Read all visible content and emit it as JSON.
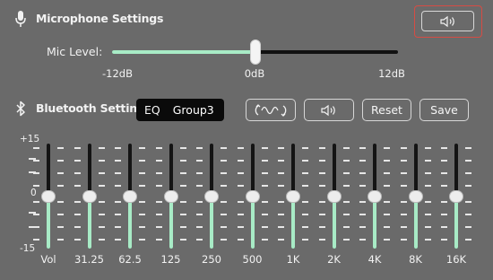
{
  "mic_section": {
    "title": "Microphone Settings",
    "icon": "microphone-icon",
    "speaker_icon": "speaker-icon",
    "mic_level_label": "Mic Level:",
    "mic_level_value_db": 0,
    "mic_level_range_db": [
      -12,
      12
    ],
    "scale_labels": [
      "-12dB",
      "0dB",
      "12dB"
    ]
  },
  "bt_section": {
    "title": "Bluetooth Settings",
    "icon": "bluetooth-icon",
    "eq_label": "EQ",
    "eq_preset": "Group3",
    "wave_icon": "waveform-sync-icon",
    "speaker_icon": "speaker-icon",
    "reset_label": "Reset",
    "save_label": "Save"
  },
  "eq": {
    "axis_labels": {
      "max": "+15",
      "mid": "0",
      "min": "-15"
    },
    "range_db": [
      -15,
      15
    ],
    "bands": [
      {
        "label": "Vol",
        "value": 0
      },
      {
        "label": "31.25",
        "value": 0
      },
      {
        "label": "62.5",
        "value": 0
      },
      {
        "label": "125",
        "value": 0
      },
      {
        "label": "250",
        "value": 0
      },
      {
        "label": "500",
        "value": 0
      },
      {
        "label": "1K",
        "value": 0
      },
      {
        "label": "2K",
        "value": 0
      },
      {
        "label": "4K",
        "value": 0
      },
      {
        "label": "8K",
        "value": 0
      },
      {
        "label": "16K",
        "value": 0
      }
    ]
  },
  "colors": {
    "background": "#6a6a6a",
    "accent_fill": "#a8ebc6",
    "track": "#141414",
    "highlight_border": "#d64c44"
  }
}
